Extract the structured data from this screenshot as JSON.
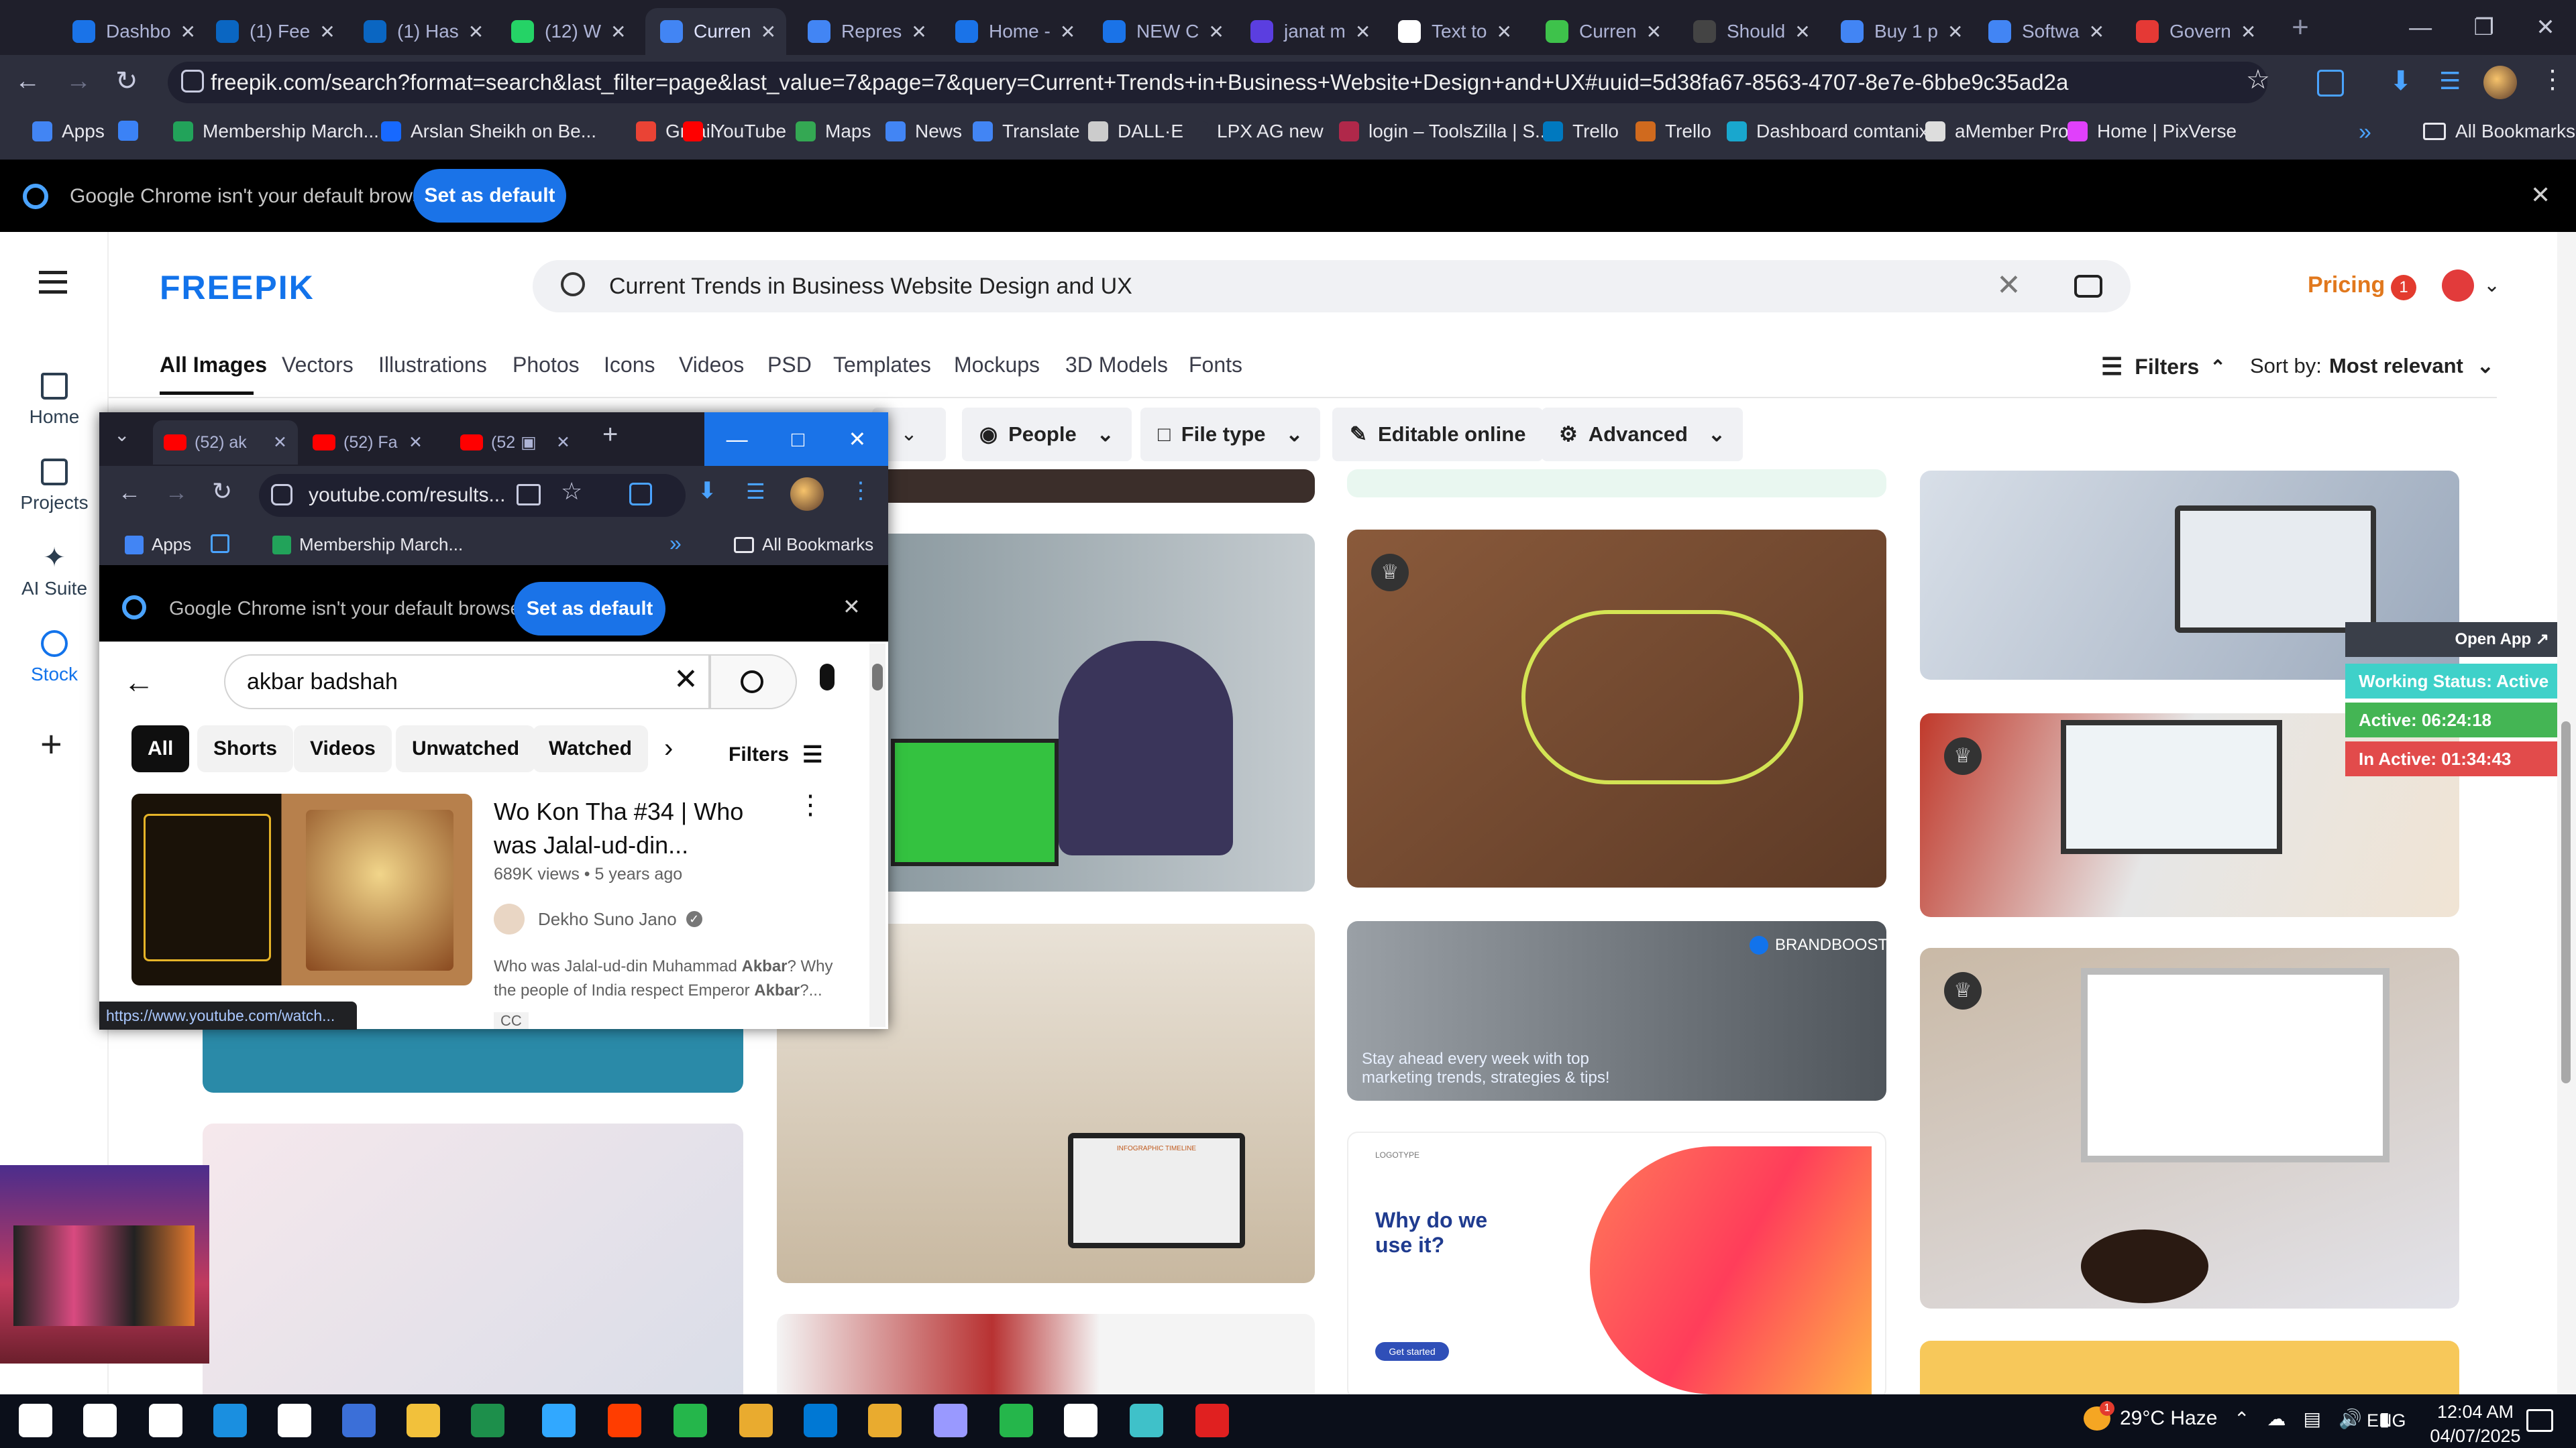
{
  "browser": {
    "tabs": [
      {
        "title": "Dashbo",
        "color": "#1a73e8"
      },
      {
        "title": "(1) Fee",
        "color": "#0a66c2"
      },
      {
        "title": "(1) Has",
        "color": "#0a66c2"
      },
      {
        "title": "(12) W",
        "color": "#25d366"
      },
      {
        "title": "Curren",
        "color": "#4285f4"
      },
      {
        "title": "Repres",
        "color": "#4285f4"
      },
      {
        "title": "Home -",
        "color": "#1a73e8"
      },
      {
        "title": "NEW C",
        "color": "#1a73e8"
      },
      {
        "title": "janat m",
        "color": "#5b3ee0"
      },
      {
        "title": "Text to",
        "color": "#ffffff"
      },
      {
        "title": "Curren",
        "color": "#3ec24b"
      },
      {
        "title": "Should",
        "color": "#444444"
      },
      {
        "title": "Buy 1 p",
        "color": "#4285f4"
      },
      {
        "title": "Softwa",
        "color": "#4285f4"
      },
      {
        "title": "Govern",
        "color": "#e53935"
      }
    ],
    "url": "freepik.com/search?format=search&last_filter=page&last_value=7&page=7&query=Current+Trends+in+Business+Website+Design+and+UX#uuid=5d38fa67-8563-4707-8e7e-6bbe9c35ad2a",
    "bookmarks": [
      {
        "label": "Apps",
        "color": "#4285f4"
      },
      {
        "label": "",
        "color": "#3b82f6"
      },
      {
        "label": "Membership March...",
        "color": "#22a35a"
      },
      {
        "label": "Arslan Sheikh on Be...",
        "color": "#1769ff"
      },
      {
        "label": "Gmail",
        "color": "#ea4335"
      },
      {
        "label": "YouTube",
        "color": "#ff0000"
      },
      {
        "label": "Maps",
        "color": "#34a853"
      },
      {
        "label": "News",
        "color": "#4285f4"
      },
      {
        "label": "Translate",
        "color": "#4285f4"
      },
      {
        "label": "DALL·E 2",
        "color": "#cccccc"
      },
      {
        "label": "LPX AG new",
        "color": "#2d2f3d"
      },
      {
        "label": "login – ToolsZilla | S...",
        "color": "#b0284a"
      },
      {
        "label": "Trello",
        "color": "#0079bf"
      },
      {
        "label": "Trello",
        "color": "#d06a1e"
      },
      {
        "label": "Dashboard comtanix",
        "color": "#19a7ce"
      },
      {
        "label": "aMember Pro",
        "color": "#dddddd"
      },
      {
        "label": "Home | PixVerse",
        "color": "#e040fb"
      }
    ],
    "all_bookmarks": "All Bookmarks",
    "default_msg": "Google Chrome isn't your default browser",
    "set_default": "Set as default"
  },
  "freepik": {
    "logo": "FREEPIK",
    "search": "Current Trends in Business Website Design and UX",
    "pricing": "Pricing",
    "notif_count": "1",
    "nav": [
      "Home",
      "Projects",
      "AI Suite",
      "Stock"
    ],
    "tabs": [
      "All Images",
      "Vectors",
      "Illustrations",
      "Photos",
      "Icons",
      "Videos",
      "PSD",
      "Templates",
      "Mockups",
      "3D Models",
      "Fonts"
    ],
    "filters": "Filters",
    "sort_label": "Sort by:",
    "sort_value": "Most relevant",
    "chips": [
      "People",
      "File type",
      "Editable online",
      "Advanced"
    ],
    "brandboost": "BRANDBOOST",
    "brandboost_text": "Stay ahead every week with top marketing trends, strategies & tips!",
    "why_title": "Why do we use it?",
    "get_started": "Get started",
    "logotype": "LOGOTYPE",
    "infographic": "INFOGRAPHIC TIMELINE"
  },
  "tracker": {
    "open_app": "Open App ↗",
    "working": "Working Status: Active",
    "active": "Active: 06:24:18",
    "inactive": "In Active: 01:34:43"
  },
  "yt": {
    "tabs": [
      "(52) ak",
      "(52) Fa",
      "(52"
    ],
    "url": "youtube.com/results...",
    "bookmarks": [
      "Apps",
      "Membership March..."
    ],
    "all_bookmarks": "All Bookmarks",
    "default_msg": "Google Chrome isn't your default browser",
    "set_default": "Set as default",
    "query": "akbar badshah",
    "chips": [
      "All",
      "Shorts",
      "Videos",
      "Unwatched",
      "Watched"
    ],
    "filters": "Filters",
    "video_title": "Wo Kon Tha #34 | Who was Jalal-ud-din...",
    "meta": "689K views • 5 years ago",
    "channel": "Dekho Suno Jano",
    "desc_a": "Who was Jalal-ud-din Muhammad ",
    "desc_b": "Akbar",
    "desc_c": "? Why the people of India respect Emperor ",
    "desc_d": "Akbar",
    "desc_e": "?...",
    "cc": "CC",
    "hover_url": "https://www.youtube.com/watch..."
  },
  "taskbar": {
    "weather": "29°C Haze",
    "weather_badge": "1",
    "lang": "ENG",
    "time": "12:04 AM",
    "date": "04/07/2025",
    "apps": [
      "#ffffff",
      "#ffffff",
      "#ffffff",
      "#1a8fe0",
      "#ffffff",
      "#3b6fd8",
      "#f2c13b",
      "#1d8f4b",
      "#31a8ff",
      "#ff3d00",
      "#25b64b",
      "#e9ab2f",
      "#0078d4",
      "#e9ab2f",
      "#9999ff",
      "#25b64b",
      "#ffffff",
      "#3fc1c9",
      "#e02020"
    ]
  }
}
